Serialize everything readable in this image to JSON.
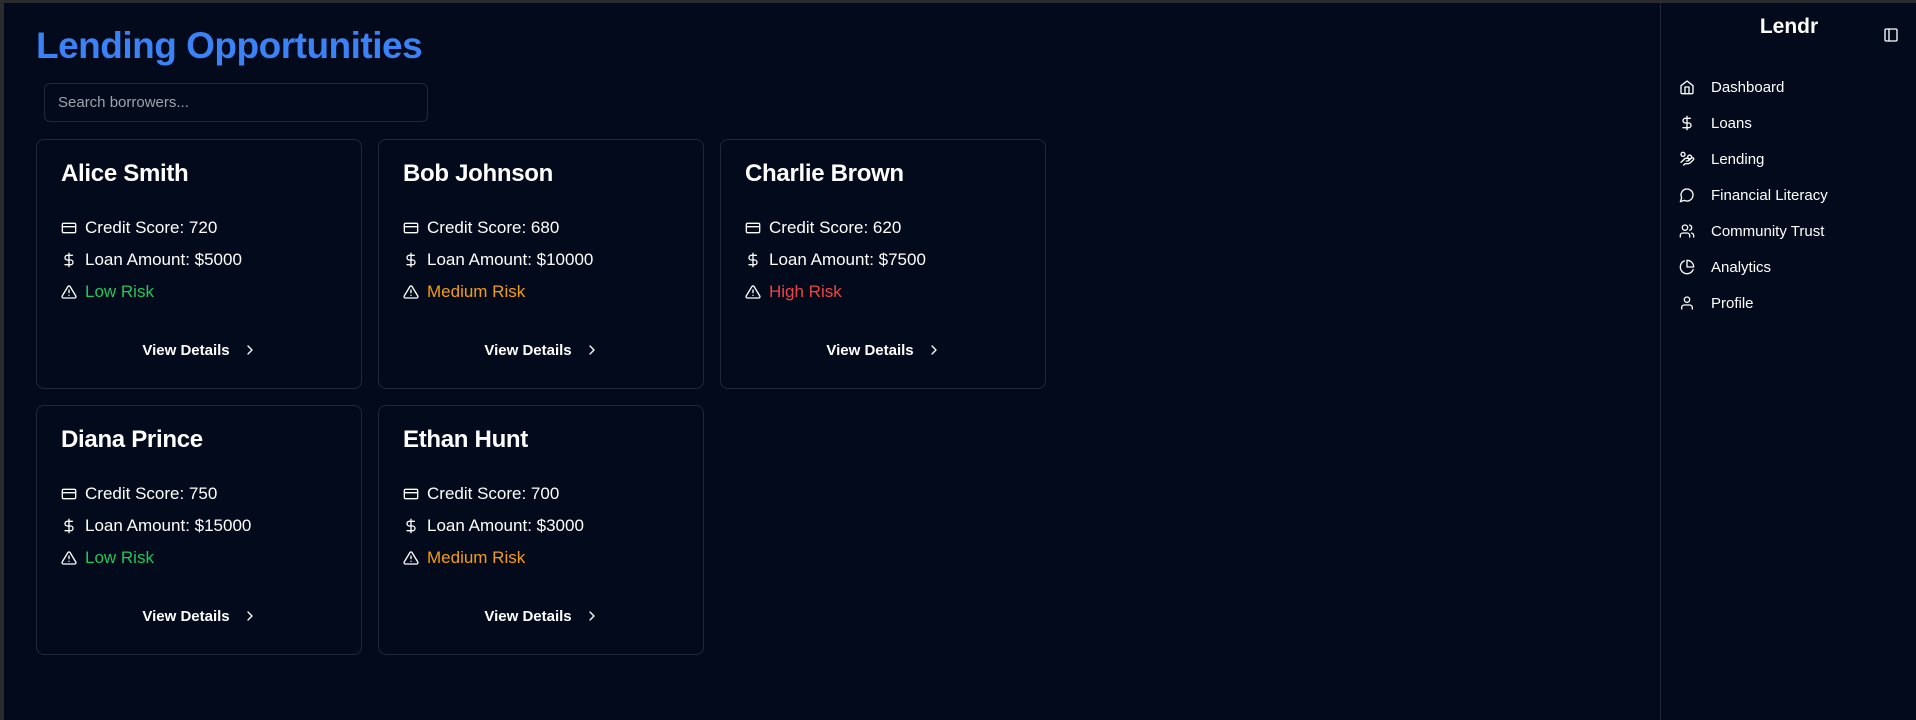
{
  "header": {
    "title": "Lending Opportunities"
  },
  "search": {
    "placeholder": "Search borrowers..."
  },
  "colors": {
    "accent": "#3b82f6",
    "low_risk": "#22c55e",
    "medium_risk": "#f59e0b",
    "high_risk": "#ef4444",
    "background": "#030a1c"
  },
  "borrowers": [
    {
      "name": "Alice Smith",
      "credit": "Credit Score: 720",
      "loan": "Loan Amount: $5000",
      "risk": "Low Risk",
      "risk_level": "low",
      "button": "View Details"
    },
    {
      "name": "Bob Johnson",
      "credit": "Credit Score: 680",
      "loan": "Loan Amount: $10000",
      "risk": "Medium Risk",
      "risk_level": "medium",
      "button": "View Details"
    },
    {
      "name": "Charlie Brown",
      "credit": "Credit Score: 620",
      "loan": "Loan Amount: $7500",
      "risk": "High Risk",
      "risk_level": "high",
      "button": "View Details"
    },
    {
      "name": "Diana Prince",
      "credit": "Credit Score: 750",
      "loan": "Loan Amount: $15000",
      "risk": "Low Risk",
      "risk_level": "low",
      "button": "View Details"
    },
    {
      "name": "Ethan Hunt",
      "credit": "Credit Score: 700",
      "loan": "Loan Amount: $3000",
      "risk": "Medium Risk",
      "risk_level": "medium",
      "button": "View Details"
    }
  ],
  "sidebar": {
    "brand": "Lendr",
    "toggle_icon": "panel-left-icon",
    "items": [
      {
        "label": "Dashboard",
        "icon": "home-icon"
      },
      {
        "label": "Loans",
        "icon": "dollar-icon"
      },
      {
        "label": "Lending",
        "icon": "hand-coins-icon"
      },
      {
        "label": "Financial Literacy",
        "icon": "message-circle-icon"
      },
      {
        "label": "Community Trust",
        "icon": "users-icon"
      },
      {
        "label": "Analytics",
        "icon": "pie-chart-icon"
      },
      {
        "label": "Profile",
        "icon": "user-icon"
      }
    ]
  }
}
